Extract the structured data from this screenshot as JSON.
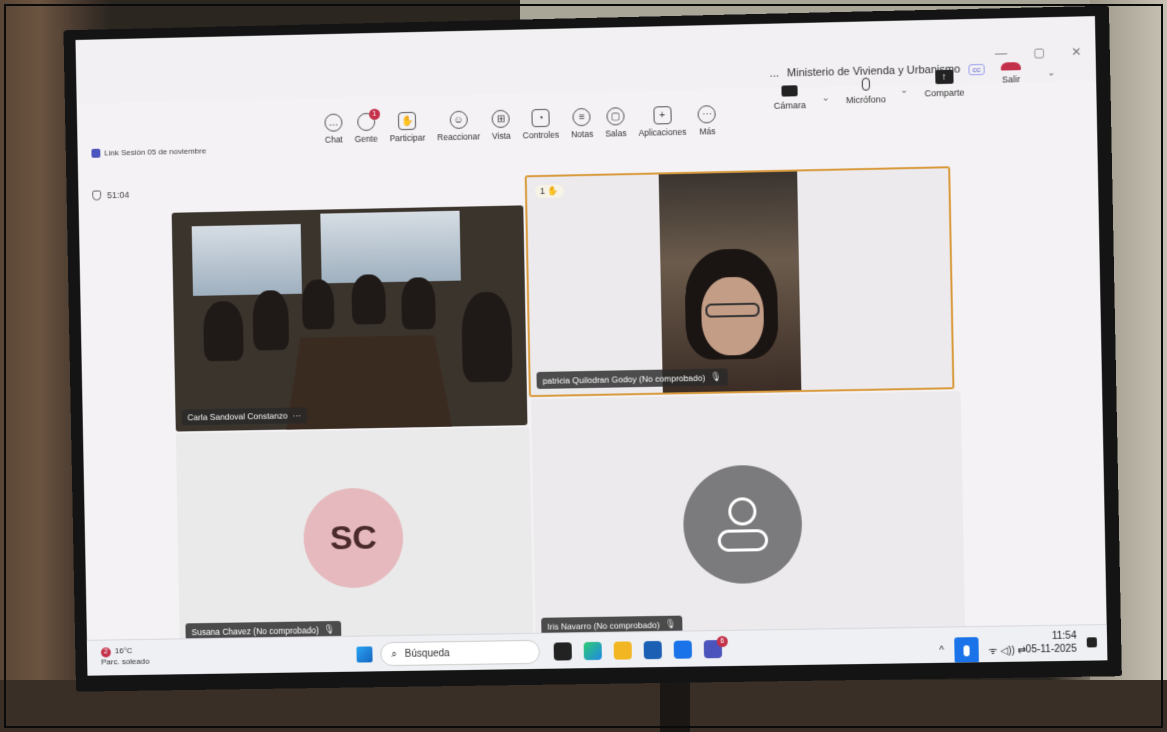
{
  "window": {
    "title": "Ministerio de Vivienda y Urbanismo",
    "more": "...",
    "cc": "cc",
    "minimize": "—",
    "maximize": "▢",
    "close": "✕"
  },
  "meeting": {
    "name": "Link Sesión 05 de noviembre",
    "timer": "51:04"
  },
  "toolbar": {
    "items": [
      {
        "label": "Chat",
        "icon": "chat-icon",
        "glyph": "…"
      },
      {
        "label": "Gente",
        "icon": "people-icon",
        "glyph": "",
        "badge": "1"
      },
      {
        "label": "Participar",
        "icon": "raise-hand-icon",
        "glyph": "✋"
      },
      {
        "label": "Reaccionar",
        "icon": "react-icon",
        "glyph": "☺"
      },
      {
        "label": "Vista",
        "icon": "view-icon",
        "glyph": "⊞"
      },
      {
        "label": "Controles",
        "icon": "controls-icon",
        "glyph": "◔"
      },
      {
        "label": "Notas",
        "icon": "notes-icon",
        "glyph": "≡"
      },
      {
        "label": "Salas",
        "icon": "rooms-icon",
        "glyph": "▢"
      },
      {
        "label": "Aplicaciones",
        "icon": "apps-icon",
        "glyph": "+"
      },
      {
        "label": "Más",
        "icon": "more-icon",
        "glyph": "⋯"
      }
    ],
    "camera": "Cámara",
    "microphone": "Micrófono",
    "share": "Comparte",
    "leave": "Salir",
    "share_glyph": "↑",
    "chevron": "⌄"
  },
  "participants": {
    "tile1": {
      "name": "Carla Sandoval Constanzo",
      "more": "···"
    },
    "tile2": {
      "name": "patricia Quilodran Godoy (No comprobado)",
      "hand_count": "1",
      "hand_glyph": "✋"
    },
    "tile3": {
      "name": "Susana Chavez (No comprobado)",
      "initials": "SC"
    },
    "tile4": {
      "name": "Iris Navarro (No comprobado)"
    },
    "mute_glyph": "🎙"
  },
  "taskbar": {
    "weather_temp": "16°C",
    "weather_desc": "Parc. soleado",
    "weather_badge": "2",
    "search_placeholder": "Búsqueda",
    "teams_badge": "6",
    "chevron_up": "^",
    "tray_icons": "ᯤ ◁)) ⇄",
    "time": "11:54",
    "date": "05-11-2025"
  }
}
